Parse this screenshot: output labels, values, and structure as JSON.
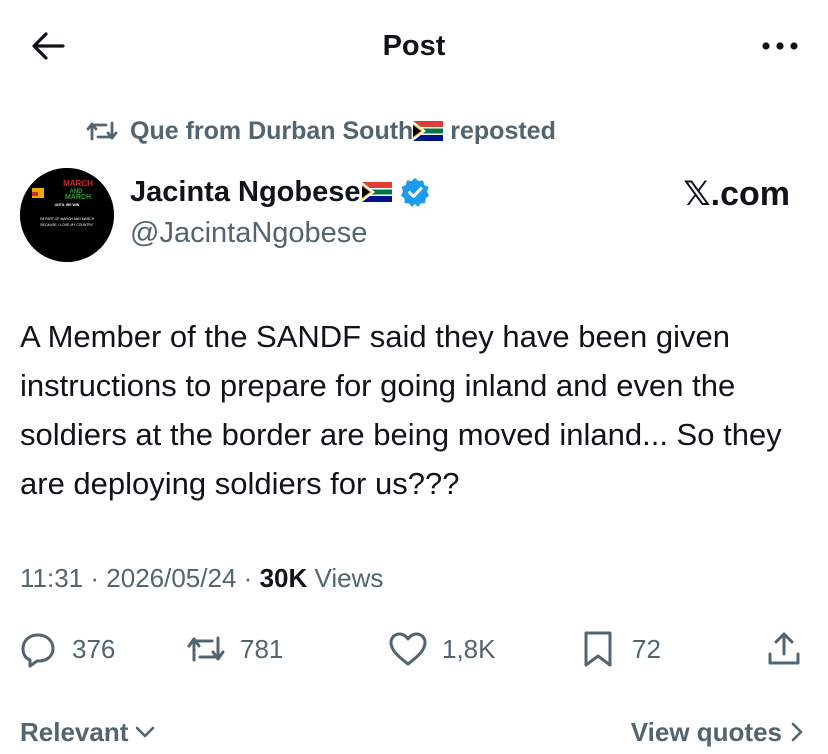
{
  "header": {
    "title": "Post"
  },
  "repost": {
    "text": "Que from Durban South",
    "suffix": " reposted"
  },
  "author": {
    "name": "Jacinta Ngobese",
    "handle": "@JacintaNgobese",
    "verified": true,
    "avatar_text": {
      "line1": "MARCH",
      "line2": "AND",
      "line3": "MARCH",
      "line4": "UNTIL WE WIN",
      "line5": "I'M PART OF MARCH AND MARCH",
      "line6": "BECAUSE, I LOVE MY COUNTRY."
    }
  },
  "source_label": "𝕏.com",
  "tweet": {
    "text": "A Member of the SANDF said they have been given instructions to prepare for going inland and even the soldiers at the border are being moved inland... So they are deploying soldiers for us???"
  },
  "meta": {
    "time": "11:31",
    "date": "2026/05/24",
    "views_count": "30K",
    "views_label": "Views",
    "separator": "·"
  },
  "actions": {
    "replies": "376",
    "reposts": "781",
    "likes": "1,8K",
    "bookmarks": "72"
  },
  "footer": {
    "sort_label": "Relevant",
    "quotes_label": "View quotes"
  },
  "icons": {
    "back": "arrow-left-icon",
    "more": "more-horizontal-icon",
    "repost": "repost-icon",
    "verified": "verified-badge-icon",
    "reply": "reply-icon",
    "like": "heart-icon",
    "bookmark": "bookmark-icon",
    "share": "share-icon",
    "chevron_down": "chevron-down-icon",
    "chevron_right": "chevron-right-icon"
  },
  "colors": {
    "text": "#0f1419",
    "secondary": "#536471",
    "verified": "#1d9bf0"
  }
}
